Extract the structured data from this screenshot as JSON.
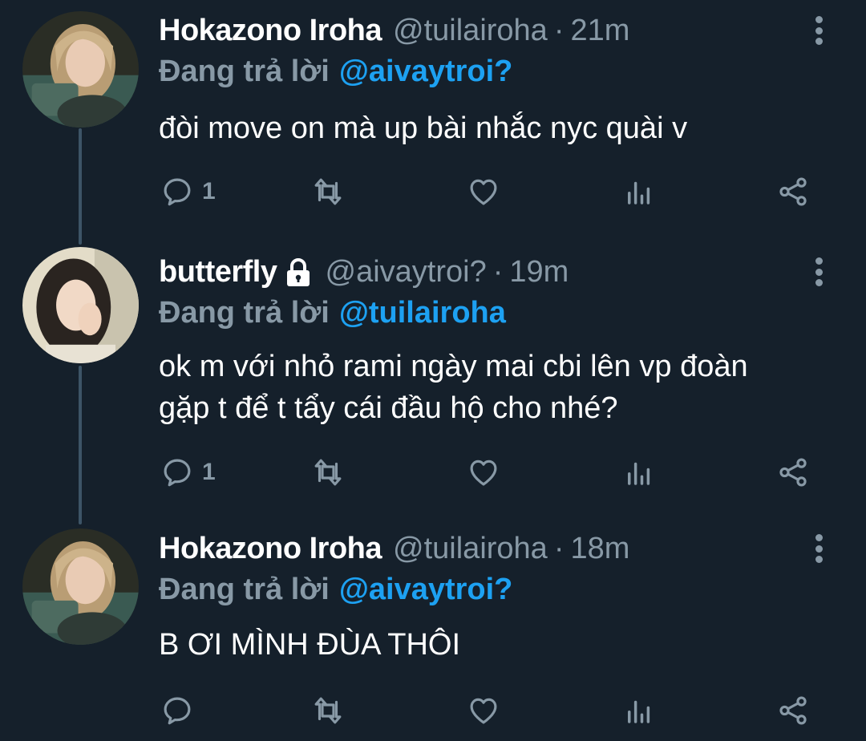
{
  "tweets": [
    {
      "name": "Hokazono Iroha",
      "handle": "@tuilairoha",
      "separator": "·",
      "time": "21m",
      "reply_prefix": "Đang trả lời",
      "reply_to": "@aivaytroi?",
      "lines": [
        "đòi move on mà up bài nhắc nyc quài v"
      ],
      "reply_count": "1",
      "locked": false
    },
    {
      "name": "butterfly",
      "handle": "@aivaytroi?",
      "separator": "·",
      "time": "19m",
      "reply_prefix": "Đang trả lời",
      "reply_to": "@tuilairoha",
      "lines": [
        "ok m với nhỏ rami ngày mai cbi lên vp đoàn",
        "gặp t để t tẩy cái đầu hộ cho nhé?"
      ],
      "reply_count": "1",
      "locked": true
    },
    {
      "name": "Hokazono Iroha",
      "handle": "@tuilairoha",
      "separator": "·",
      "time": "18m",
      "reply_prefix": "Đang trả lời",
      "reply_to": "@aivaytroi?",
      "lines": [
        "B ƠI MÌNH ĐÙA THÔI"
      ],
      "reply_count": "",
      "locked": false
    }
  ],
  "icons": {
    "reply": "reply-icon",
    "retweet": "retweet-icon",
    "like": "like-icon",
    "analytics": "analytics-icon",
    "share": "share-icon",
    "more": "more-icon",
    "lock": "lock-icon"
  },
  "colors": {
    "background": "#15202b",
    "secondary_text": "#8899a6",
    "accent": "#1da1f2",
    "thread_line": "#3d5466"
  }
}
